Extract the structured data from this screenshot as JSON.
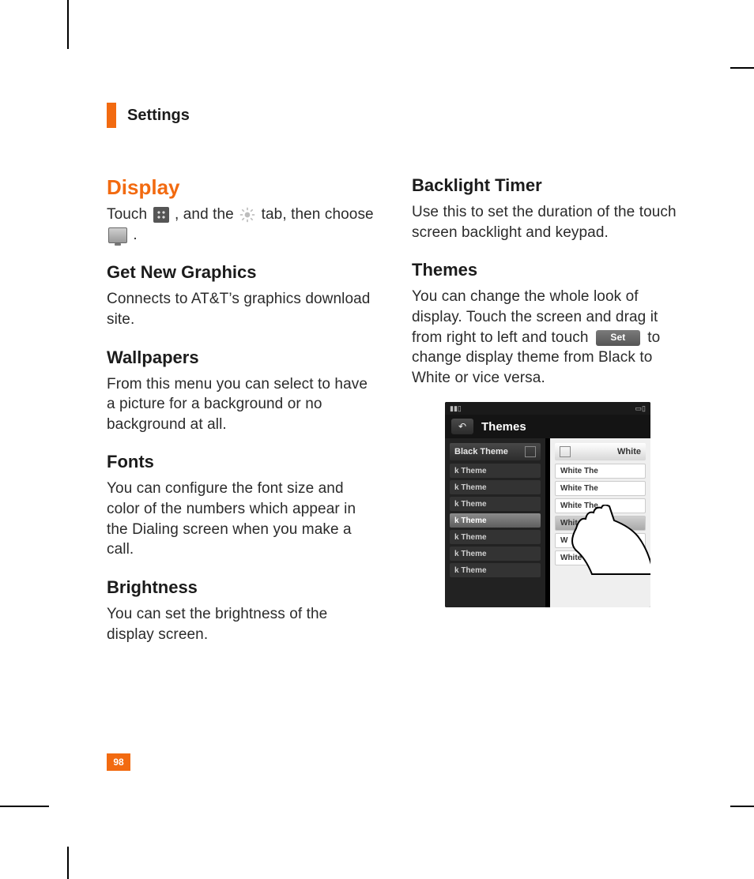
{
  "header": {
    "title": "Settings"
  },
  "page_number": "98",
  "left": {
    "display_heading": "Display",
    "touch_pre": "Touch ",
    "touch_mid": ", and the ",
    "touch_post": " tab, then choose",
    "touch_end": ".",
    "icons": {
      "grid": "apps-grid-icon",
      "gear": "gear-icon",
      "monitor": "monitor-icon"
    },
    "sections": {
      "graphics": {
        "h": "Get New Graphics",
        "p": "Connects to AT&T’s graphics download site."
      },
      "wallpapers": {
        "h": "Wallpapers",
        "p": "From this menu you can select to have a picture for a background or no background at all."
      },
      "fonts": {
        "h": "Fonts",
        "p": "You can configure the font size and color of the numbers which appear in the Dialing screen when you make a call."
      },
      "brightness": {
        "h": "Brightness",
        "p": "You can set the brightness of the display screen."
      }
    }
  },
  "right": {
    "backlight": {
      "h": "Backlight Timer",
      "p": "Use this to set the duration of the touch screen backlight and keypad."
    },
    "themes": {
      "h": "Themes",
      "p_pre": "You can change the whole look of display. Touch the screen and drag it from right to left and touch ",
      "set_label": "Set",
      "p_post": " to change display theme from Black to White or vice versa."
    }
  },
  "screenshot": {
    "title": "Themes",
    "dark_head": "Black Theme",
    "light_head": "White",
    "dark_rows": [
      "k Theme",
      "k Theme",
      "k Theme",
      "k Theme",
      "k Theme",
      "k Theme",
      "k Theme"
    ],
    "light_rows": [
      "White The",
      "White The",
      "White The",
      "White The",
      "W",
      "White"
    ],
    "selected_dark_index": 3,
    "selected_light_index": 3
  }
}
